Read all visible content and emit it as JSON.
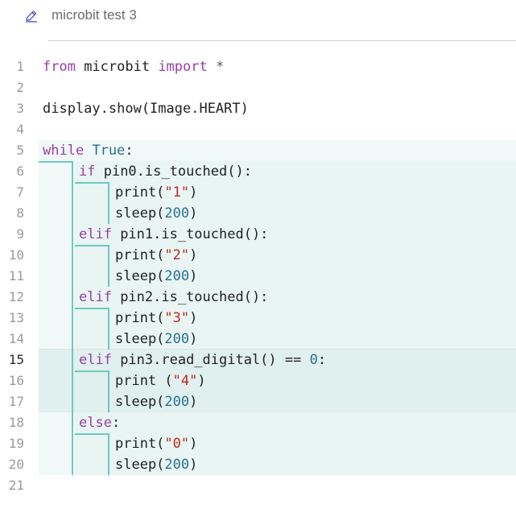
{
  "header": {
    "title": "microbit test 3",
    "edit_icon": "pencil-icon"
  },
  "editor": {
    "active_line": 15,
    "lines": [
      {
        "n": "1",
        "indent": 0,
        "tokens": [
          [
            "kw",
            "from"
          ],
          [
            "t",
            " microbit "
          ],
          [
            "kw",
            "import"
          ],
          [
            "op",
            " *"
          ]
        ]
      },
      {
        "n": "2",
        "indent": 0,
        "tokens": []
      },
      {
        "n": "3",
        "indent": 0,
        "tokens": [
          [
            "t",
            "display.show(Image.HEART)"
          ]
        ]
      },
      {
        "n": "4",
        "indent": 0,
        "tokens": []
      },
      {
        "n": "5",
        "indent": 0,
        "tokens": [
          [
            "kw",
            "while"
          ],
          [
            "t",
            " "
          ],
          [
            "num",
            "True"
          ],
          [
            "t",
            ":"
          ]
        ]
      },
      {
        "n": "6",
        "indent": 1,
        "tokens": [
          [
            "kw",
            "if"
          ],
          [
            "t",
            " pin0.is_touched():"
          ]
        ]
      },
      {
        "n": "7",
        "indent": 2,
        "tokens": [
          [
            "t",
            "print("
          ],
          [
            "str",
            "\"1\""
          ],
          [
            "t",
            ")"
          ]
        ]
      },
      {
        "n": "8",
        "indent": 2,
        "tokens": [
          [
            "t",
            "sleep("
          ],
          [
            "num",
            "200"
          ],
          [
            "t",
            ")"
          ]
        ]
      },
      {
        "n": "9",
        "indent": 1,
        "tokens": [
          [
            "kw",
            "elif"
          ],
          [
            "t",
            " pin1.is_touched():"
          ]
        ]
      },
      {
        "n": "10",
        "indent": 2,
        "tokens": [
          [
            "t",
            "print("
          ],
          [
            "str",
            "\"2\""
          ],
          [
            "t",
            ")"
          ]
        ]
      },
      {
        "n": "11",
        "indent": 2,
        "tokens": [
          [
            "t",
            "sleep("
          ],
          [
            "num",
            "200"
          ],
          [
            "t",
            ")"
          ]
        ]
      },
      {
        "n": "12",
        "indent": 1,
        "tokens": [
          [
            "kw",
            "elif"
          ],
          [
            "t",
            " pin2.is_touched():"
          ]
        ]
      },
      {
        "n": "13",
        "indent": 2,
        "tokens": [
          [
            "t",
            "print("
          ],
          [
            "str",
            "\"3\""
          ],
          [
            "t",
            ")"
          ]
        ]
      },
      {
        "n": "14",
        "indent": 2,
        "tokens": [
          [
            "t",
            "sleep("
          ],
          [
            "num",
            "200"
          ],
          [
            "t",
            ")"
          ]
        ]
      },
      {
        "n": "15",
        "indent": 1,
        "tokens": [
          [
            "kw",
            "elif"
          ],
          [
            "t",
            " pin3.read_digital() == "
          ],
          [
            "num",
            "0"
          ],
          [
            "t",
            ":"
          ]
        ]
      },
      {
        "n": "16",
        "indent": 2,
        "tokens": [
          [
            "t",
            "print ("
          ],
          [
            "str",
            "\"4\""
          ],
          [
            "t",
            ")"
          ]
        ]
      },
      {
        "n": "17",
        "indent": 2,
        "tokens": [
          [
            "t",
            "sleep("
          ],
          [
            "num",
            "200"
          ],
          [
            "t",
            ")"
          ]
        ]
      },
      {
        "n": "18",
        "indent": 1,
        "tokens": [
          [
            "kw",
            "else"
          ],
          [
            "t",
            ":"
          ]
        ]
      },
      {
        "n": "19",
        "indent": 2,
        "tokens": [
          [
            "t",
            "print("
          ],
          [
            "str",
            "\"0\""
          ],
          [
            "t",
            ")"
          ]
        ]
      },
      {
        "n": "20",
        "indent": 2,
        "tokens": [
          [
            "t",
            "sleep("
          ],
          [
            "num",
            "200"
          ],
          [
            "t",
            ")"
          ]
        ]
      },
      {
        "n": "21",
        "indent": 0,
        "tokens": []
      }
    ]
  },
  "colors": {
    "block_bg": "#f1f9f8",
    "block_inner_bg": "#e8f5f3",
    "block_active_bg": "#dff0ee",
    "indent_guide": "#6dc9bd",
    "keyword": "#9c3ea6",
    "string": "#c0291f",
    "number": "#2a6f8f"
  }
}
